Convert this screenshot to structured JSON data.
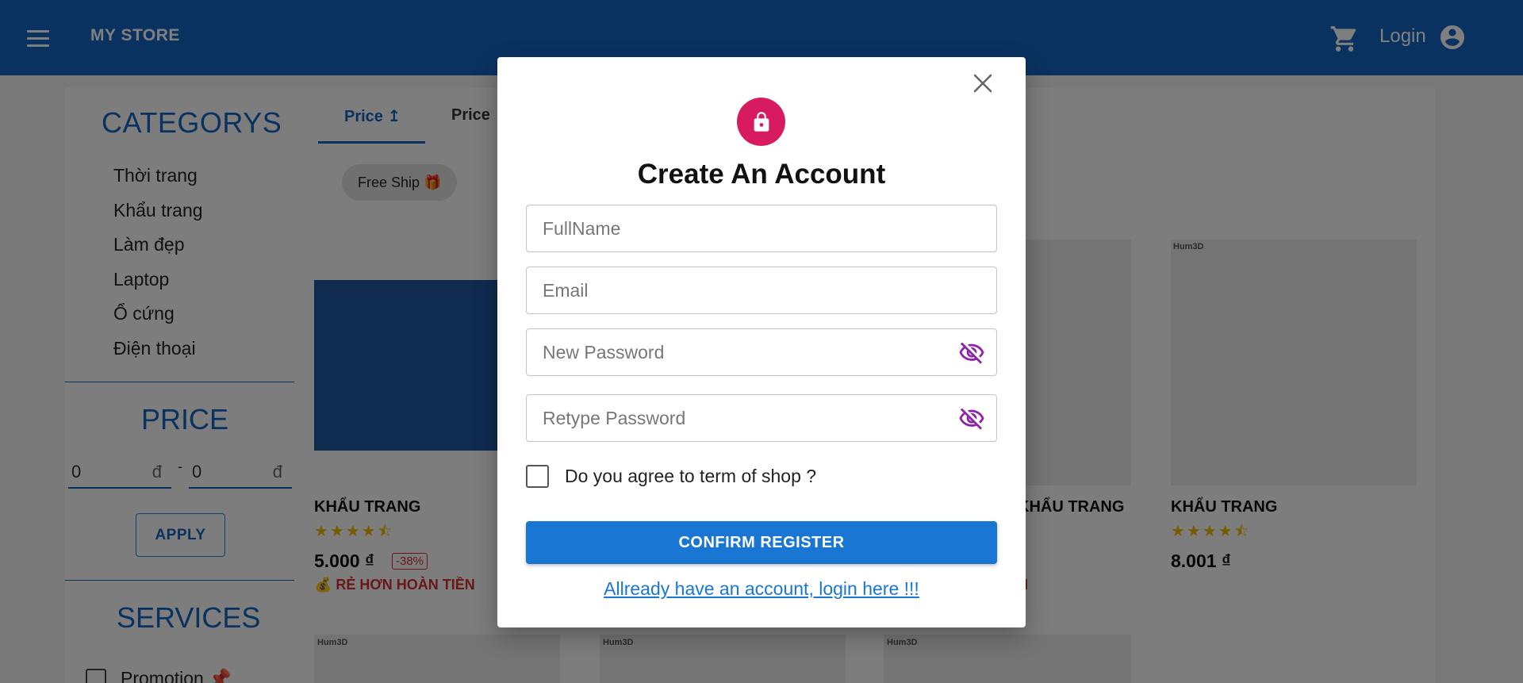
{
  "header": {
    "brand": "MY STORE",
    "login_label": "Login",
    "colors": {
      "appbar": "#1565c0"
    },
    "icons": [
      "menu-icon",
      "cart-icon",
      "account-circle-icon"
    ]
  },
  "sidebar": {
    "categories_title": "CATEGORYS",
    "categories": [
      "Thời trang",
      "Khẩu trang",
      "Làm đẹp",
      "Laptop",
      "Ổ cứng",
      "Điện thoại"
    ],
    "price_title": "PRICE",
    "price_min": "0",
    "price_max": "0",
    "currency": "đ",
    "price_separator": "-",
    "apply_label": "APPLY",
    "services_title": "SERVICES",
    "promotion_label": "Promotion 📌"
  },
  "toolbar": {
    "tabs": [
      "Price ↥",
      "Price"
    ],
    "chip_label": "Free Ship 🎁"
  },
  "products": [
    {
      "title": "KHẨU TRANG",
      "price": "5.000 ₫",
      "discount": "-38%",
      "refund": "💰 RẺ HƠN HOÀN TIỀN",
      "rating": 4.5
    },
    {
      "title": "KHẨU TRANG",
      "refund_partial": "N",
      "rating": 4.5
    },
    {
      "title": "KHẨU TRANG",
      "price": "8.001 ₫",
      "rating": 4.5
    }
  ],
  "misc": {
    "hum3d": "Hum3D"
  },
  "modal": {
    "title": "Create An Account",
    "fullname_placeholder": "FullName",
    "email_placeholder": "Email",
    "new_password_placeholder": "New Password",
    "retype_password_placeholder": "Retype Password",
    "agree_label": "Do you agree to term of shop ?",
    "confirm_label": "CONFIRM REGISTER",
    "login_link": "Allready have an account, login here !!!",
    "colors": {
      "lock": "#d81b60",
      "confirm": "#1976d2",
      "eye": "#8e24aa"
    }
  }
}
